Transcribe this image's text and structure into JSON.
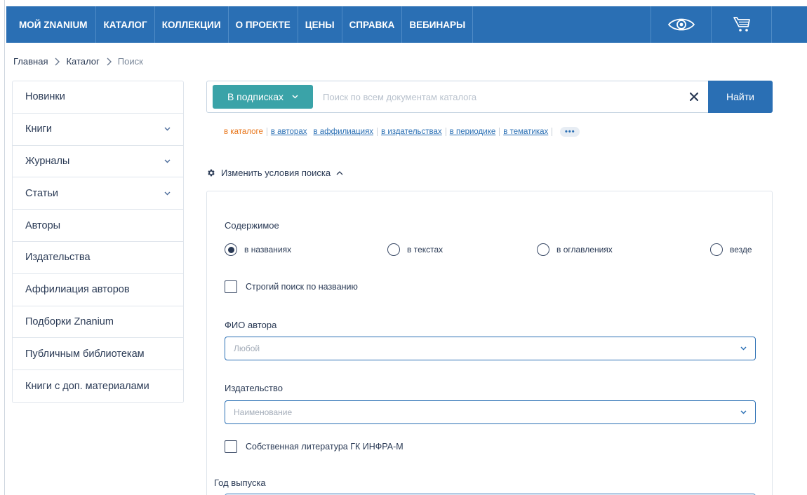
{
  "nav": {
    "items": [
      "МОЙ ZNANIUM",
      "КАТАЛОГ",
      "КОЛЛЕКЦИИ",
      "О ПРОЕКТЕ",
      "ЦЕНЫ",
      "СПРАВКА",
      "ВЕБИНАРЫ"
    ],
    "icons": [
      "eye-icon",
      "cart-icon"
    ]
  },
  "breadcrumb": {
    "items": [
      "Главная",
      "Каталог",
      "Поиск"
    ]
  },
  "sidebar": {
    "items": [
      {
        "label": "Новинки",
        "expandable": false
      },
      {
        "label": "Книги",
        "expandable": true
      },
      {
        "label": "Журналы",
        "expandable": true
      },
      {
        "label": "Статьи",
        "expandable": true
      },
      {
        "label": "Авторы",
        "expandable": false
      },
      {
        "label": "Издательства",
        "expandable": false
      },
      {
        "label": "Аффилиация авторов",
        "expandable": false
      },
      {
        "label": "Подборки Znanium",
        "expandable": false
      },
      {
        "label": "Публичным библиотекам",
        "expandable": false
      },
      {
        "label": "Книги с доп. материалами",
        "expandable": false
      }
    ]
  },
  "search": {
    "scope_label": "В подписках",
    "placeholder": "Поиск по всем документам каталога",
    "value": "",
    "submit_label": "Найти"
  },
  "scopes": {
    "active": "в каталоге",
    "links": [
      "в авторах",
      "в аффилиациях",
      "в издательствах",
      "в периодике",
      "в тематиках"
    ],
    "more": "•••"
  },
  "conditions": {
    "toggle_label": "Изменить условия поиска",
    "content_label": "Содержимое",
    "content_options": [
      {
        "label": "в названиях",
        "selected": true
      },
      {
        "label": "в текстах",
        "selected": false
      },
      {
        "label": "в оглавлениях",
        "selected": false
      },
      {
        "label": "везде",
        "selected": false
      }
    ],
    "strict_label": "Строгий поиск по названию",
    "strict_checked": false,
    "author_label": "ФИО автора",
    "author_placeholder": "Любой",
    "publisher_label": "Издательство",
    "publisher_placeholder": "Наименование",
    "own_lit_label": "Собственная литература ГК ИНФРА-М",
    "own_lit_checked": false,
    "year_label": "Год выпуска"
  },
  "colors": {
    "nav": "#2a6fb4",
    "scope_button": "#3aa3a8",
    "active_scope": "#e8761b",
    "link": "#2a6fb4"
  }
}
